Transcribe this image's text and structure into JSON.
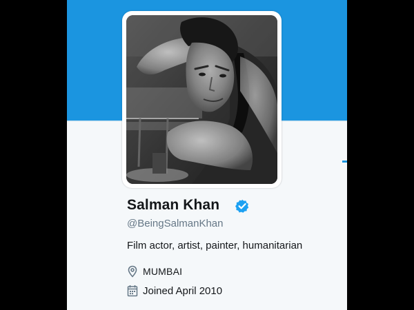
{
  "colors": {
    "header_banner": "#1b95e0",
    "profile_background": "#f5f8fa",
    "letterbox": "#000000",
    "verified_badge": "#1da1f2",
    "meta_icon": "#657786",
    "tab_indicator": "#1b95e0"
  },
  "profile": {
    "avatar_description_icon": "profile-photo",
    "display_name": "Salman Khan",
    "verified": true,
    "screen_name": "@BeingSalmanKhan",
    "bio": "Film actor, artist, painter, humanitarian",
    "location": "MUMBAI",
    "joined": "Joined April 2010"
  },
  "icons": {
    "verified": "verified-badge-icon",
    "location": "map-pin-icon",
    "joined": "calendar-icon"
  }
}
